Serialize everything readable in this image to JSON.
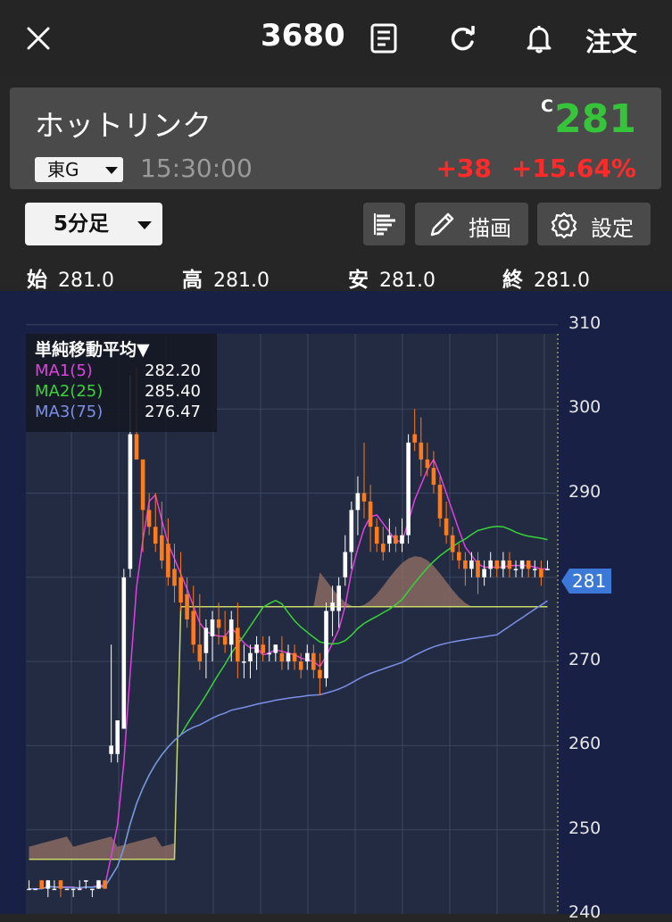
{
  "header": {
    "code": "3680",
    "order_label": "注文"
  },
  "stock": {
    "name": "ホットリンク",
    "price_flag": "C",
    "price": "281",
    "market": "東G",
    "time": "15:30:00",
    "change": "+38",
    "change_pct": "+15.64%"
  },
  "toolbar": {
    "interval": "5分足",
    "draw_label": "描画",
    "settings_label": "設定"
  },
  "ohlc": [
    {
      "label": "始",
      "value": "281.0"
    },
    {
      "label": "高",
      "value": "281.0"
    },
    {
      "label": "安",
      "value": "281.0"
    },
    {
      "label": "終",
      "value": "281.0"
    }
  ],
  "legend": {
    "title": "単純移動平均▼",
    "rows": [
      {
        "name": "MA1(5)",
        "value": "282.20",
        "color": "#e040e0"
      },
      {
        "name": "MA2(25)",
        "value": "285.40",
        "color": "#39d339"
      },
      {
        "name": "MA3(75)",
        "value": "276.47",
        "color": "#7b8fe8"
      }
    ]
  },
  "price_tag": "281",
  "colors": {
    "up": "#ffffff",
    "down": "#ff7a1a",
    "price_green": "#36c43a",
    "change_red": "#ff2b2b",
    "tag_blue": "#3b78d8"
  },
  "chart_data": {
    "type": "candlestick",
    "ylim": [
      240,
      310
    ],
    "yticks": [
      "310",
      "300",
      "290",
      "270",
      "260",
      "250",
      "240"
    ],
    "grid": true,
    "candles": [
      [
        243,
        244,
        243,
        243
      ],
      [
        243,
        243,
        243,
        243
      ],
      [
        244,
        244,
        243,
        243
      ],
      [
        243,
        244,
        242,
        244
      ],
      [
        243,
        244,
        243,
        243
      ],
      [
        244,
        244,
        242,
        243
      ],
      [
        243,
        243,
        243,
        243
      ],
      [
        243,
        243,
        242,
        243
      ],
      [
        243,
        244,
        243,
        243
      ],
      [
        244,
        244,
        243,
        244
      ],
      [
        243,
        243,
        242,
        243
      ],
      [
        243,
        244,
        243,
        244
      ],
      [
        244,
        244,
        243,
        243
      ],
      [
        259,
        272,
        258,
        260
      ],
      [
        259,
        263,
        258,
        263
      ],
      [
        262,
        281,
        262,
        280
      ],
      [
        281,
        304,
        280,
        297
      ],
      [
        297,
        305,
        294,
        294
      ],
      [
        294,
        294,
        283,
        288
      ],
      [
        288,
        290,
        285,
        286
      ],
      [
        286,
        290,
        283,
        284
      ],
      [
        285,
        289,
        281,
        282
      ],
      [
        284,
        287,
        279,
        280
      ],
      [
        281,
        284,
        277,
        279
      ],
      [
        280,
        283,
        276,
        277
      ],
      [
        278,
        280,
        274,
        275
      ],
      [
        276,
        279,
        271,
        272
      ],
      [
        272,
        278,
        269,
        270
      ],
      [
        271,
        275,
        268,
        274
      ],
      [
        273,
        276,
        270,
        275
      ],
      [
        275,
        277,
        272,
        274
      ],
      [
        273,
        276,
        271,
        272
      ],
      [
        272,
        276,
        270,
        275
      ],
      [
        274,
        277,
        268,
        270
      ],
      [
        270,
        272,
        268,
        270
      ],
      [
        270,
        272,
        268,
        271
      ],
      [
        271,
        273,
        269,
        272
      ],
      [
        272,
        273,
        270,
        271
      ],
      [
        271,
        273,
        270,
        271
      ],
      [
        271,
        272,
        270,
        272
      ],
      [
        271,
        273,
        269,
        270
      ],
      [
        270,
        272,
        269,
        271
      ],
      [
        271,
        272,
        269,
        270
      ],
      [
        270,
        271,
        268,
        269
      ],
      [
        270,
        272,
        269,
        271
      ],
      [
        271,
        272,
        268,
        269
      ],
      [
        269,
        271,
        266,
        268
      ],
      [
        268,
        277,
        267,
        276
      ],
      [
        276,
        279,
        273,
        277
      ],
      [
        276,
        280,
        274,
        279
      ],
      [
        280,
        285,
        279,
        283
      ],
      [
        283,
        289,
        281,
        288
      ],
      [
        288,
        292,
        285,
        290
      ],
      [
        290,
        296,
        287,
        289
      ],
      [
        289,
        291,
        283,
        286
      ],
      [
        286,
        287,
        283,
        284
      ],
      [
        284,
        286,
        282,
        283
      ],
      [
        284,
        287,
        283,
        285
      ],
      [
        285,
        286,
        283,
        284
      ],
      [
        284,
        287,
        283,
        285
      ],
      [
        285,
        297,
        284,
        296
      ],
      [
        297,
        300,
        295,
        296
      ],
      [
        296,
        299,
        292,
        294
      ],
      [
        294,
        296,
        292,
        293
      ],
      [
        293,
        295,
        290,
        291
      ],
      [
        291,
        292,
        286,
        287
      ],
      [
        287,
        289,
        284,
        285
      ],
      [
        285,
        286,
        282,
        283
      ],
      [
        283,
        284,
        281,
        282
      ],
      [
        282,
        283,
        279,
        281
      ],
      [
        281,
        283,
        280,
        282
      ],
      [
        282,
        283,
        278,
        280
      ],
      [
        280,
        282,
        279,
        281
      ],
      [
        281,
        283,
        280,
        282
      ],
      [
        282,
        282,
        280,
        281
      ],
      [
        281,
        283,
        280,
        282
      ],
      [
        282,
        283,
        280,
        281
      ],
      [
        281,
        282,
        280,
        281
      ],
      [
        281,
        282,
        280,
        282
      ],
      [
        282,
        282,
        280,
        281
      ],
      [
        281,
        282,
        280,
        281
      ],
      [
        281,
        282,
        279,
        280
      ],
      [
        281,
        282,
        281,
        281
      ]
    ]
  }
}
